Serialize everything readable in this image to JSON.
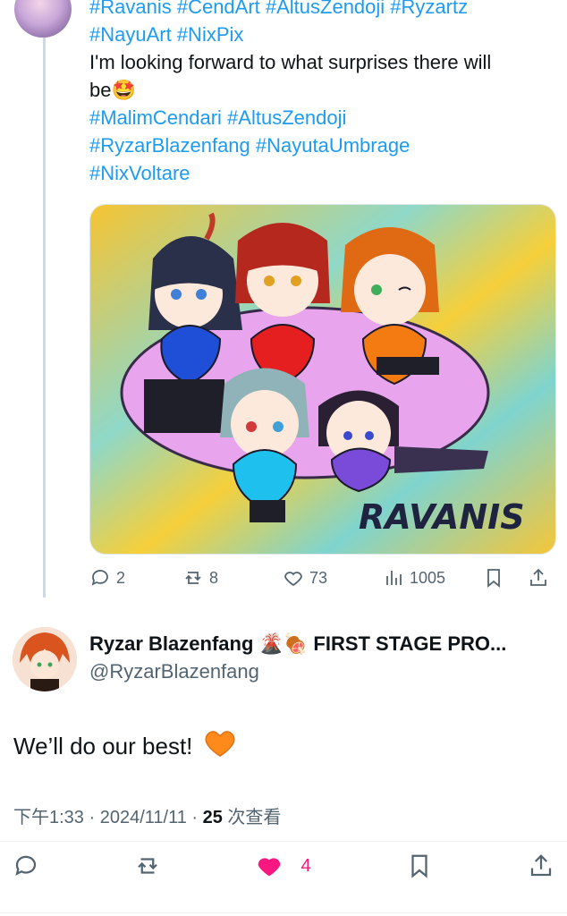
{
  "original_post": {
    "lines": [
      {
        "type": "tag",
        "text": "#Ravanis #CendArt #AltusZendoji #Ryzartz"
      },
      {
        "type": "tag",
        "text": "#NayuArt #NixPix"
      },
      {
        "type": "text",
        "text": "I'm looking forward to what surprises there will"
      },
      {
        "type": "text",
        "text": "be🤩"
      },
      {
        "type": "tag",
        "text": "#MalimCendari #AltusZendoji"
      },
      {
        "type": "tag",
        "text": "#RyzarBlazenfang #NayutaUmbrage"
      },
      {
        "type": "tag",
        "text": "#NixVoltare"
      }
    ],
    "image_caption": "RAVANIS",
    "stats": {
      "replies": "2",
      "reposts": "8",
      "likes": "73",
      "views": "1005"
    }
  },
  "reply": {
    "display_name": "Ryzar Blazenfang 🌋🍖 FIRST STAGE PRO...",
    "handle": "@RyzarBlazenfang",
    "text": "We’ll do our best!",
    "meta": {
      "time_date": "下午1:33 · 2024/11/11 · ",
      "views_count": "25",
      "views_label": " 次查看"
    },
    "likes": "4"
  },
  "colors": {
    "link": "#1d9bf0",
    "like_active": "#f91880",
    "secondary_text": "#536471",
    "heart_orange": "#ff8a1c"
  }
}
